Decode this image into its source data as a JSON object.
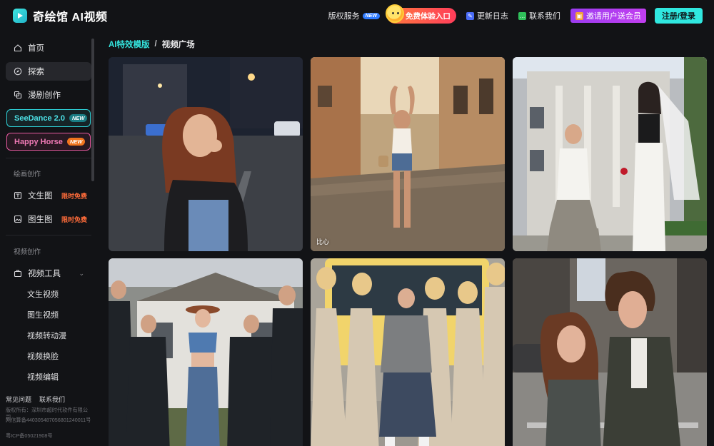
{
  "header": {
    "app_name": "奇绘馆 AI视频",
    "links": {
      "copyright": "版权服务",
      "copyright_badge": "NEW",
      "trial": "免费体验入口",
      "changelog": "更新日志",
      "contact": "联系我们",
      "invite": "邀请用户送会员",
      "login": "注册/登录"
    }
  },
  "sidebar": {
    "items": {
      "home": "首页",
      "explore": "探索",
      "comic": "漫剧创作"
    },
    "pills": {
      "seedance": "SeeDance 2.0",
      "seedance_tag": "NEW",
      "horse": "Happy Horse",
      "horse_tag": "NEW"
    },
    "painting_section": "绘画创作",
    "painting": {
      "text2img": "文生图",
      "text2img_tag": "限时免费",
      "img2img": "图生图",
      "img2img_tag": "限时免费"
    },
    "video_section": "视频创作",
    "video_tools": "视频工具",
    "video_sub": {
      "t2v": "文生视频",
      "i2v": "图生视频",
      "anime": "视频转动漫",
      "faceswap": "视频换脸",
      "edit": "视频编辑"
    },
    "footer": {
      "faq": "常见问题",
      "contact": "联系我们",
      "copyright": "版权所有：深圳市超时代软件有限公司",
      "netcert": "网信算备440305487056801240011号",
      "icp": "粤ICP备05021908号"
    }
  },
  "main": {
    "breadcrumb": {
      "parent": "AI特效模版",
      "separator": "/",
      "current": "视频广场"
    },
    "cards": [
      {
        "caption": "",
        "scene": "blowing-kiss-street-night"
      },
      {
        "caption": "比心",
        "scene": "heart-gesture-street"
      },
      {
        "caption": "",
        "scene": "proposal-kneeling"
      },
      {
        "caption": "",
        "scene": "group-men-suits-cowgirl"
      },
      {
        "caption": "",
        "scene": "group-women-dresses-boy"
      },
      {
        "caption": "",
        "scene": "couple-city-street"
      }
    ]
  },
  "colors": {
    "accent": "#30e8e0",
    "background": "#121316",
    "invite": "#a83cf0",
    "trial": "#ff4d4d",
    "free_tag": "#ff6c3a"
  }
}
